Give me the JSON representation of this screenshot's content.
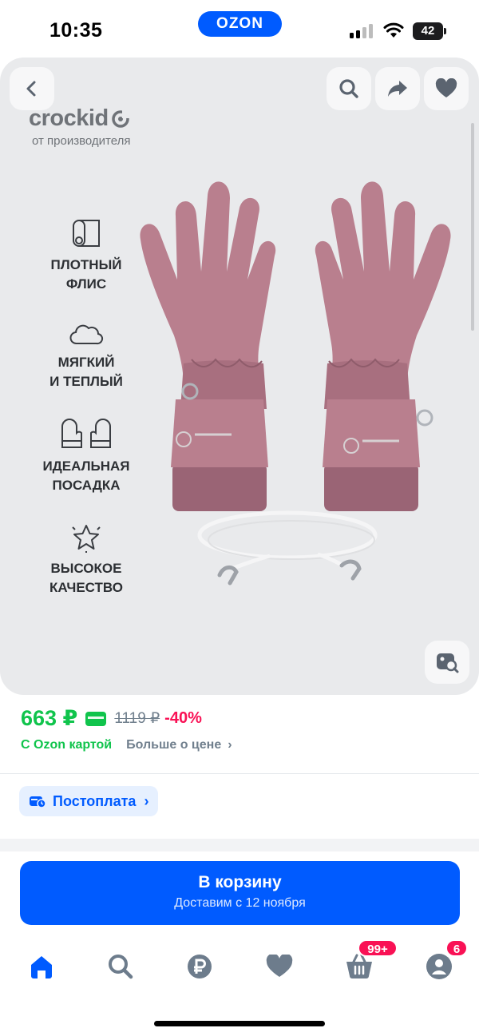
{
  "status_bar": {
    "time": "10:35",
    "app_pill": "OZON",
    "battery": "42"
  },
  "gallery": {
    "brand": "crockid",
    "brand_sub": "от производителя",
    "features": [
      {
        "line1": "ПЛОТНЫЙ",
        "line2": "ФЛИС",
        "icon": "fleece-roll-icon"
      },
      {
        "line1": "МЯГКИЙ",
        "line2": "И ТЕПЛЫЙ",
        "icon": "cloud-icon"
      },
      {
        "line1": "ИДЕАЛЬНАЯ",
        "line2": "ПОСАДКА",
        "icon": "mittens-icon"
      },
      {
        "line1": "ВЫСОКОЕ",
        "line2": "КАЧЕСТВО",
        "icon": "star-icon"
      }
    ],
    "glove_color": "#b97f8e",
    "background": "#e9eaec"
  },
  "price": {
    "current": "663 ₽",
    "old": "1119 ₽",
    "discount": "-40%",
    "ozon_card": "С Ozon картой",
    "more": "Больше о цене",
    "more_chevron": "›",
    "colors": {
      "green": "#10c44c",
      "red": "#f91155"
    }
  },
  "postpay": {
    "label": "Постоплата",
    "chevron": "›"
  },
  "cart_button": {
    "label": "В корзину",
    "sub": "Доставим с 12 ноября",
    "color": "#005bff"
  },
  "bottom_nav": {
    "items": [
      "home-icon",
      "search-icon",
      "ruble-icon",
      "heart-icon",
      "cart-icon",
      "profile-icon"
    ],
    "cart_badge": "99+",
    "profile_badge": "6"
  }
}
